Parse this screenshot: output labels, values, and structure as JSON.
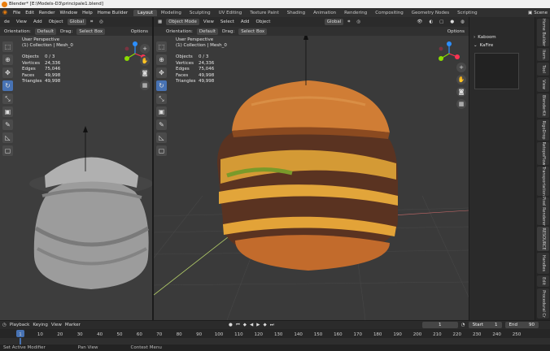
{
  "window": {
    "title": "Blender* [E:\\Models-D3\\principale1.blend]"
  },
  "menu": {
    "items": [
      "File",
      "Edit",
      "Render",
      "Window",
      "Help",
      "Home Builder"
    ],
    "tabs": [
      "Layout",
      "Modeling",
      "Sculpting",
      "UV Editing",
      "Texture Paint",
      "Shading",
      "Animation",
      "Rendering",
      "Compositing",
      "Geometry Nodes",
      "Scripting"
    ],
    "active_tab": "Layout",
    "scene_label": "Scene"
  },
  "left_viewport": {
    "header": {
      "mode": "de",
      "view": "View",
      "add": "Add",
      "object": "Object",
      "global": "Global"
    },
    "header2": {
      "orientation_label": "Orientation:",
      "orientation_value": "Default",
      "drag_label": "Drag:",
      "drag_value": "Select Box",
      "options": "Options"
    },
    "overlay": {
      "perspective": "User Perspective",
      "collection": "(1) Collection | Mesh_0"
    },
    "stats": [
      {
        "label": "Objects",
        "value": "0 / 3"
      },
      {
        "label": "Vertices",
        "value": "24,336"
      },
      {
        "label": "Edges",
        "value": "75,046"
      },
      {
        "label": "Faces",
        "value": "49,998"
      },
      {
        "label": "Triangles",
        "value": "49,998"
      }
    ]
  },
  "main_viewport": {
    "header": {
      "mode": "Object Mode",
      "view": "View",
      "select": "Select",
      "add": "Add",
      "object": "Object",
      "global": "Global"
    },
    "header2": {
      "orientation_label": "Orientation:",
      "orientation_value": "Default",
      "drag_label": "Drag:",
      "drag_value": "Select Box",
      "options": "Options"
    },
    "overlay": {
      "perspective": "User Perspective",
      "collection": "(1) Collection | Mesh_0"
    },
    "stats": [
      {
        "label": "Objects",
        "value": "0 / 3"
      },
      {
        "label": "Vertices",
        "value": "24,336"
      },
      {
        "label": "Edges",
        "value": "75,046"
      },
      {
        "label": "Faces",
        "value": "49,998"
      },
      {
        "label": "Triangles",
        "value": "49,998"
      }
    ]
  },
  "outliner": {
    "items": [
      "Kaboom",
      "KaFire"
    ]
  },
  "sidebar_tabs": [
    "Home Builder",
    "Item",
    "Tool",
    "View",
    "BlenderKit",
    "RigoDrop",
    "RetopoFlow",
    "Transportation",
    "Pixel Renderer",
    "RESOURCE",
    "Handles",
    "Edit",
    "Procedural Cr"
  ],
  "timeline": {
    "playback": "Playback",
    "keying": "Keying",
    "view": "View",
    "marker": "Marker",
    "current_frame": "1",
    "start_label": "Start",
    "start": "1",
    "end_label": "End",
    "end": "90",
    "ticks": [
      "1",
      "10",
      "20",
      "30",
      "40",
      "50",
      "60",
      "70",
      "80",
      "90",
      "100",
      "110",
      "120",
      "130",
      "140",
      "150",
      "160",
      "170",
      "180",
      "190",
      "200",
      "210",
      "220",
      "230",
      "240",
      "250"
    ]
  },
  "status": {
    "left": "Set Active Modifier",
    "middle": "Pan View",
    "right": "Context Menu"
  },
  "colors": {
    "accent": "#4772b3",
    "frame_marker": "#4772b3",
    "blender_orange": "#e87d0d"
  }
}
